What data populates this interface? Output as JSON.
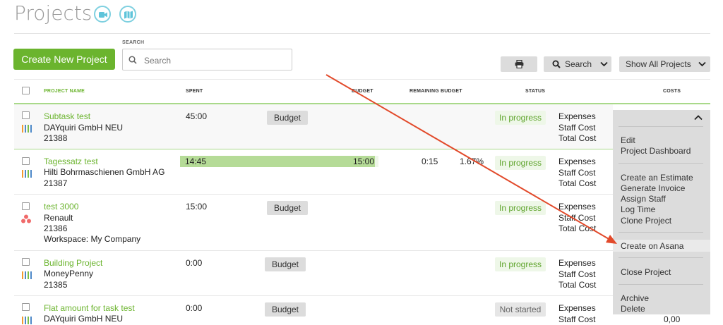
{
  "page": {
    "title": "Projects"
  },
  "toolbar": {
    "create_label": "Create New Project",
    "search_label": "SEARCH",
    "search_placeholder": "Search",
    "search_button_label": "Search",
    "filter_label": "Show All Projects"
  },
  "table": {
    "headers": {
      "name": "PROJECT NAME",
      "spent": "SPENT",
      "budget": "BUDGET",
      "remaining": "REMAINING BUDGET",
      "status": "STATUS",
      "costs": "COSTS"
    },
    "rows": [
      {
        "name": "Subtask test",
        "client": "DAYquiri GmbH NEU",
        "number": "21388",
        "spent": "45:00",
        "budget_button": "Budget",
        "status": "In progress",
        "cost_lines": [
          "Expenses",
          "Staff Cost",
          "Total Cost"
        ]
      },
      {
        "name": "Tagessatz test",
        "client": "Hilti Bohrmaschienen GmbH AG",
        "number": "21387",
        "spent": "14:45",
        "budget": "15:00",
        "budget_used": 0.983,
        "remaining": "0:15",
        "remaining_percent": "1.67%",
        "status": "In progress",
        "cost_lines": [
          "Expenses",
          "Staff Cost",
          "Total Cost"
        ]
      },
      {
        "name": "test 3000",
        "client": "Renault",
        "number": "21386",
        "workspace": "Workspace: My Company",
        "spent": "15:00",
        "budget_button": "Budget",
        "status": "In progress",
        "cost_lines": [
          "Expenses",
          "Staff Cost",
          "Total Cost"
        ]
      },
      {
        "name": "Building Project",
        "client": "MoneyPenny",
        "number": "21385",
        "spent": "0:00",
        "budget_button": "Budget",
        "status": "In progress",
        "cost_lines": [
          "Expenses",
          "Staff Cost",
          "Total Cost"
        ]
      },
      {
        "name": "Flat amount for task test",
        "client": "DAYquiri GmbH NEU",
        "spent": "0:00",
        "budget_button": "Budget",
        "status": "Not started",
        "cost_lines": [
          "Expenses",
          "Staff Cost"
        ],
        "cost_value": "0,00"
      }
    ]
  },
  "dropdown": {
    "items": [
      "Edit",
      "Project Dashboard",
      "Create an Estimate",
      "Generate Invoice",
      "Assign Staff",
      "Log Time",
      "Clone Project",
      "Create on Asana",
      "Close Project",
      "Archive",
      "Delete"
    ],
    "highlighted": "Create on Asana"
  },
  "colors": {
    "accent_green": "#6bb42e",
    "status_bg": "#eef7e8",
    "budget_bar": "#b5db97",
    "arrow": "#e24a2b",
    "icon_teal": "#7fd0e0",
    "bars_orange": "#f29a2e",
    "bars_blue": "#4e89c9",
    "bars_green": "#7bbf45",
    "asana_dots": "#f06a6a"
  },
  "icons": [
    "video-camera-icon",
    "map-icon",
    "search-icon",
    "printer-icon",
    "chevron-down-icon",
    "chevron-up-icon",
    "bars-icon",
    "asana-icon"
  ]
}
